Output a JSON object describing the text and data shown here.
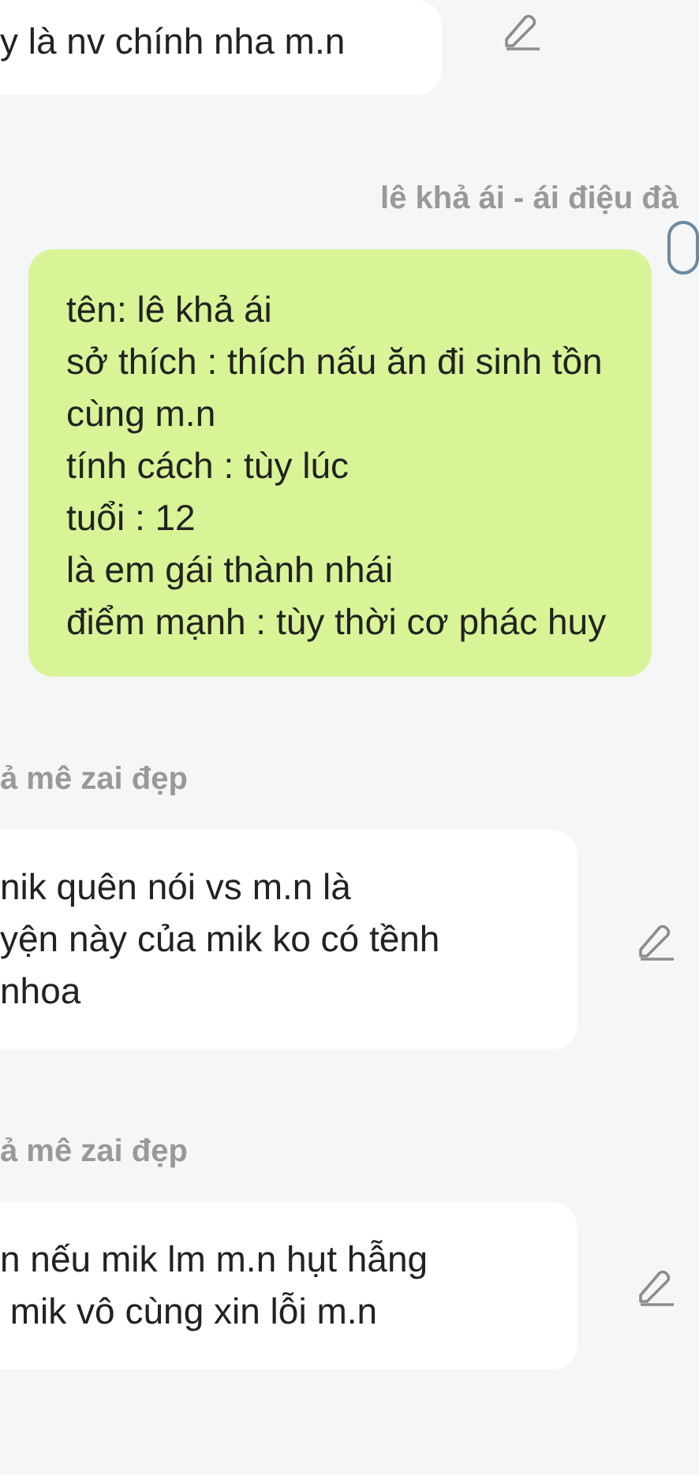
{
  "messages": [
    {
      "kind": "incoming",
      "text": "y là nv chính nha m.n"
    },
    {
      "kind": "outgoing",
      "sender": "lê khả ái - ái điệu đà",
      "text": "tên: lê khả ái\nsở thích : thích nấu ăn đi sinh tồn cùng m.n\ntính cách : tùy lúc\ntuổi : 12\nlà em gái thành nhái\nđiểm mạnh : tùy thời cơ phác huy"
    },
    {
      "kind": "incoming",
      "sender": "ả mê zai đẹp",
      "text": "nik quên nói vs m.n là\nyện này của mik ko có tềnh\nnhoa"
    },
    {
      "kind": "incoming",
      "sender": "ả mê zai đẹp",
      "text": "n nếu mik lm m.n hụt hẫng\n mik vô cùng xin lỗi m.n"
    }
  ]
}
